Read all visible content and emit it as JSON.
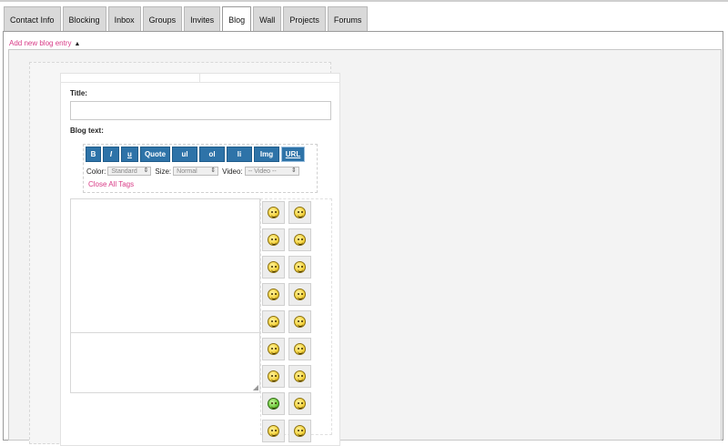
{
  "tabs": [
    {
      "label": "Contact Info",
      "active": false
    },
    {
      "label": "Blocking",
      "active": false
    },
    {
      "label": "Inbox",
      "active": false
    },
    {
      "label": "Groups",
      "active": false
    },
    {
      "label": "Invites",
      "active": false
    },
    {
      "label": "Blog",
      "active": true
    },
    {
      "label": "Wall",
      "active": false
    },
    {
      "label": "Projects",
      "active": false
    },
    {
      "label": "Forums",
      "active": false
    }
  ],
  "add_link": "Add new blog entry",
  "form": {
    "title_label": "Title:",
    "title_value": "",
    "blog_text_label": "Blog text:",
    "format_buttons": [
      "B",
      "I",
      "u",
      "Quote",
      "ul",
      "ol",
      "li",
      "Img",
      "URL"
    ],
    "color_label": "Color:",
    "color_value": "Standard",
    "size_label": "Size:",
    "size_value": "Normal",
    "video_label": "Video:",
    "video_value": "-- Video --",
    "close_tags": "Close All Tags",
    "body_value": ""
  },
  "smileys": [
    "smile-icon",
    "wink-icon",
    "cool-icon",
    "grin-icon",
    "laugh-icon",
    "smirk-icon",
    "tongue-icon",
    "big-grin-icon",
    "surprised-icon",
    "shocked-icon",
    "happy-icon",
    "worried-icon",
    "neutral-icon",
    "confused-icon",
    "sick-icon",
    "angry-icon",
    "sleepy-icon",
    "sad-icon"
  ],
  "colors": {
    "link": "#d83a86",
    "button": "#2e73a8"
  }
}
